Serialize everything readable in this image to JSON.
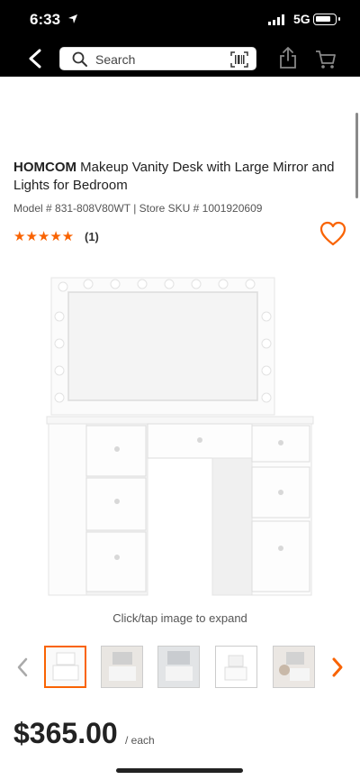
{
  "status": {
    "time": "6:33",
    "network": "5G"
  },
  "nav": {
    "search_placeholder": "Search"
  },
  "product": {
    "brand": "HOMCOM",
    "name": "Makeup Vanity Desk with Large Mirror and Lights for Bedroom",
    "model_line": "Model # 831-808V80WT  |  Store SKU # 1001920609",
    "stars": "★★★★★",
    "rating_value": 5,
    "rating_count": "(1)",
    "expand_hint": "Click/tap image to expand",
    "price": "$365.00",
    "price_unit": "/ each"
  },
  "gallery": {
    "thumb_count": 5,
    "active_index": 0
  },
  "colors": {
    "accent": "#f96302",
    "topbar": "#000000"
  }
}
